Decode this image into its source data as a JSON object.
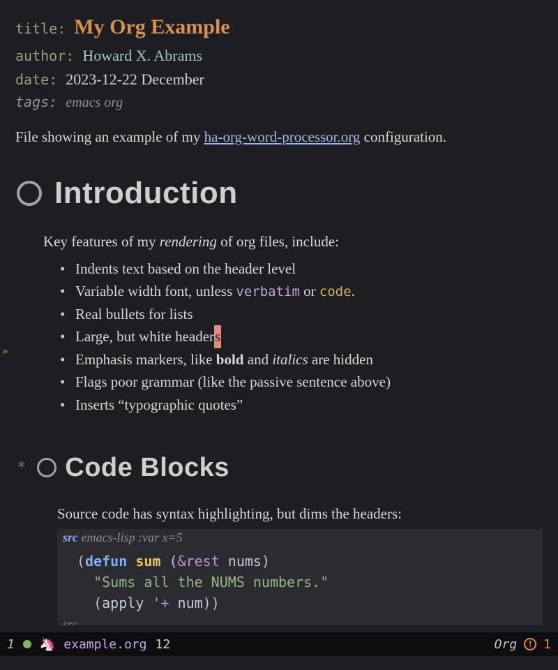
{
  "meta": {
    "title_key": "title:",
    "title": "My Org Example",
    "author_key": "author:",
    "author": "Howard X. Abrams",
    "date_key": "date:",
    "date": "2023-12-22 December",
    "tags_key": "tags:",
    "tags": "emacs org"
  },
  "intro_para": {
    "pre": "File showing an example of my ",
    "link": "ha-org-word-processor.org",
    "post": " configuration."
  },
  "sections": {
    "introduction": {
      "heading": "Introduction",
      "lead_pre": "Key features of my ",
      "lead_em": "rendering",
      "lead_post": " of org files, include:",
      "bullets": {
        "b1": "Indents text based on the header level",
        "b2_pre": "Variable width font, unless ",
        "b2_verbatim": "verbatim",
        "b2_mid": " or ",
        "b2_code": "code",
        "b2_post": ".",
        "b3": "Real bullets for lists",
        "b4_pre": "Large, but white header",
        "b4_cursor": "s",
        "b5_pre": "Emphasis markers, like ",
        "b5_bold": "bold",
        "b5_mid": " and ",
        "b5_italic": "italics",
        "b5_post": " are hidden",
        "b6": "Flags poor grammar (like the passive sentence above)",
        "b7": "Inserts “typographic quotes”"
      }
    },
    "code_blocks": {
      "star": "*",
      "heading": "Code Blocks",
      "lead": "Source code has syntax highlighting, but dims the headers:",
      "src_header_kw": "src",
      "src_header_rest": " emacs-lisp :var x=5",
      "src_footer": "src",
      "code": {
        "l1_p1": "(",
        "l1_kw": "defun",
        "l1_sp": " ",
        "l1_fn": "sum",
        "l1_sp2": " ",
        "l1_p2": "(",
        "l1_rest": "&rest",
        "l1_sp3": " ",
        "l1_id": "nums",
        "l1_p3": ")",
        "l2_indent": "  ",
        "l2_str": "\"Sums all the NUMS numbers.\"",
        "l3_indent": "  ",
        "l3_p1": "(",
        "l3_id1": "apply",
        "l3_sp": " ",
        "l3_q": "'+",
        "l3_sp2": " ",
        "l3_id2": "num",
        "l3_p2": "))"
      }
    }
  },
  "modeline": {
    "window_num": "1",
    "file": "example.org",
    "line": "12",
    "major_mode": "Org",
    "flycheck_count": "1"
  }
}
